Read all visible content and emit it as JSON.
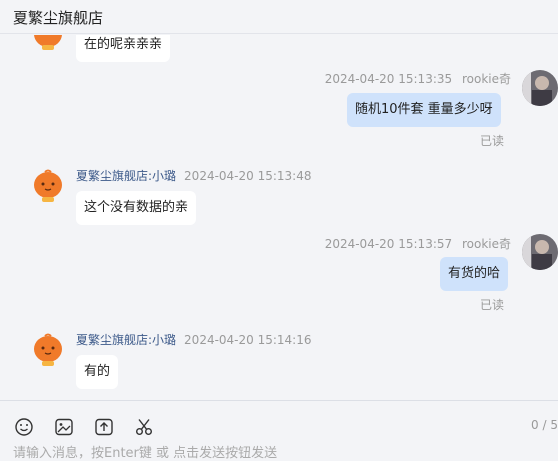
{
  "header": {
    "title": "夏繁尘旗舰店"
  },
  "messages": [
    {
      "side": "left",
      "text": "在的呢亲亲亲"
    },
    {
      "side": "right",
      "time": "2024-04-20 15:13:35",
      "user": "rookie奇",
      "text": "随机10件套  重量多少呀",
      "status": "已读"
    },
    {
      "side": "left",
      "sender": "夏繁尘旗舰店:小璐",
      "time": "2024-04-20 15:13:48",
      "text": "这个没有数据的亲"
    },
    {
      "side": "right",
      "time": "2024-04-20 15:13:57",
      "user": "rookie奇",
      "text": "有货的哈",
      "status": "已读"
    },
    {
      "side": "left",
      "sender": "夏繁尘旗舰店:小璐",
      "time": "2024-04-20 15:14:16",
      "text": "有的"
    }
  ],
  "input": {
    "placeholder": "请输入消息，按Enter键 或 点击发送按钮发送",
    "counter": "0 / 5"
  },
  "toolbar": {
    "icons": [
      "emoji-icon",
      "image-icon",
      "upload-icon",
      "scissors-icon"
    ]
  },
  "colors": {
    "own_bubble": "#cfe2fb",
    "other_bubble": "#ffffff",
    "sender_name": "#3d5a8a",
    "shop_avatar": "#f07a2a"
  }
}
